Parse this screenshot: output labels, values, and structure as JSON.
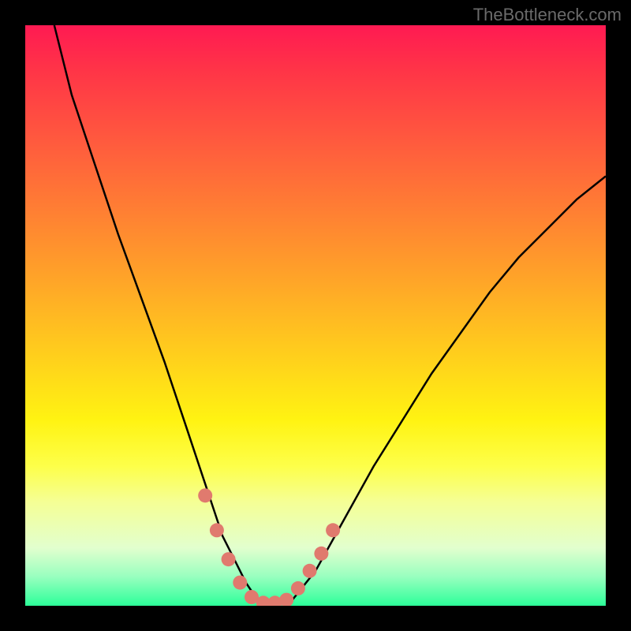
{
  "watermark": "TheBottleneck.com",
  "colors": {
    "background": "#000000",
    "curve": "#000000",
    "marker": "#e07a6e",
    "gradient_top": "#ff1a52",
    "gradient_mid": "#fff312",
    "gradient_bottom": "#2cff99"
  },
  "chart_data": {
    "type": "line",
    "title": "",
    "xlabel": "",
    "ylabel": "",
    "xlim": [
      0,
      100
    ],
    "ylim": [
      0,
      100
    ],
    "series": [
      {
        "name": "curve",
        "x": [
          5,
          8,
          12,
          16,
          20,
          24,
          28,
          30,
          32,
          34,
          36,
          38,
          40,
          42,
          44,
          46,
          50,
          55,
          60,
          65,
          70,
          75,
          80,
          85,
          90,
          95,
          100
        ],
        "y": [
          100,
          88,
          76,
          64,
          53,
          42,
          30,
          24,
          18,
          12,
          8,
          4,
          1,
          0.5,
          0.5,
          1,
          6,
          15,
          24,
          32,
          40,
          47,
          54,
          60,
          65,
          70,
          74
        ]
      }
    ],
    "markers": [
      {
        "x": 31,
        "y": 19
      },
      {
        "x": 33,
        "y": 13
      },
      {
        "x": 35,
        "y": 8
      },
      {
        "x": 37,
        "y": 4
      },
      {
        "x": 39,
        "y": 1.5
      },
      {
        "x": 41,
        "y": 0.5
      },
      {
        "x": 43,
        "y": 0.5
      },
      {
        "x": 45,
        "y": 1
      },
      {
        "x": 47,
        "y": 3
      },
      {
        "x": 49,
        "y": 6
      },
      {
        "x": 51,
        "y": 9
      },
      {
        "x": 53,
        "y": 13
      }
    ]
  }
}
